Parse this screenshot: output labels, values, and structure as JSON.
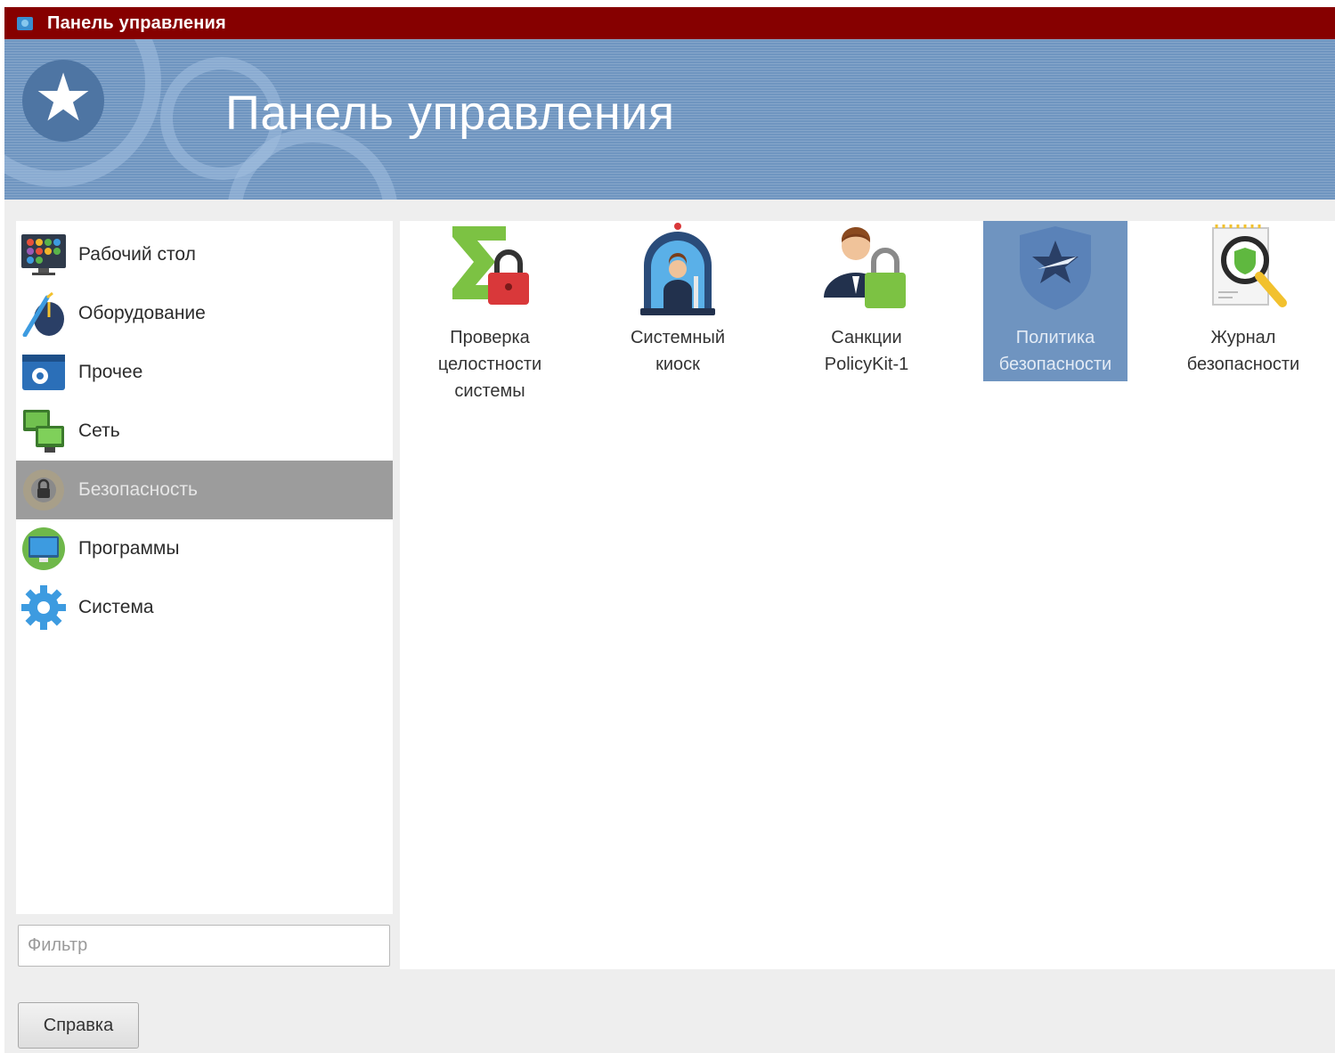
{
  "window": {
    "title": "Панель управления",
    "banner_title": "Панель управления"
  },
  "sidebar": {
    "items": [
      {
        "label": "Рабочий стол",
        "icon": "desktop-grid-icon"
      },
      {
        "label": "Оборудование",
        "icon": "hardware-mouse-icon"
      },
      {
        "label": "Прочее",
        "icon": "other-gear-window-icon"
      },
      {
        "label": "Сеть",
        "icon": "network-monitors-icon"
      },
      {
        "label": "Безопасность",
        "icon": "security-lock-icon",
        "selected": true
      },
      {
        "label": "Программы",
        "icon": "programs-monitor-icon"
      },
      {
        "label": "Система",
        "icon": "system-gear-icon"
      }
    ],
    "filter_placeholder": "Фильтр",
    "filter_value": ""
  },
  "content": {
    "tiles": [
      {
        "label": "Проверка\nцелостности\nсистемы",
        "icon": "integrity-sigma-lock-icon"
      },
      {
        "label": "Системный\nкиоск",
        "icon": "system-kiosk-icon"
      },
      {
        "label": "Санкции\nPolicyKit-1",
        "icon": "policykit-user-lock-icon"
      },
      {
        "label": "Политика\nбезопасности",
        "icon": "security-policy-shield-icon",
        "selected": true
      },
      {
        "label": "Журнал\nбезопасности",
        "icon": "security-log-magnifier-icon"
      }
    ]
  },
  "footer": {
    "help_label": "Справка"
  },
  "colors": {
    "titlebar": "#860000",
    "banner": "#6f95c0",
    "sidebar_selected": "#9c9c9c",
    "tile_selected": "#6f94c0"
  }
}
